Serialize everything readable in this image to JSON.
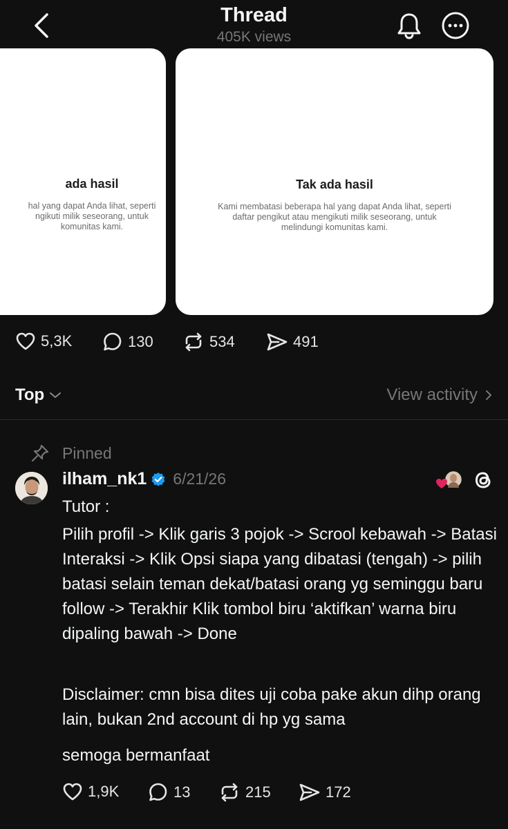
{
  "header": {
    "title": "Thread",
    "views": "405K views"
  },
  "cards": {
    "left": {
      "title": "ada hasil",
      "line1": "hal yang dapat Anda lihat, seperti",
      "line2": "ngikuti milik seseorang, untuk",
      "line3": "komunitas kami."
    },
    "right": {
      "title": "Tak ada hasil",
      "line1": "Kami membatasi beberapa hal yang dapat Anda lihat, seperti",
      "line2": "daftar pengikut atau mengikuti milik seseorang, untuk",
      "line3": "melindungi komunitas kami."
    }
  },
  "thread_actions": {
    "likes": "5,3K",
    "replies": "130",
    "reposts": "534",
    "shares": "491"
  },
  "sort": {
    "label": "Top",
    "view_activity": "View activity"
  },
  "post": {
    "pinned_label": "Pinned",
    "username": "ilham_nk1",
    "date": "6/21/26",
    "text1": "Tutor :",
    "text2": "Pilih profil -> Klik garis 3 pojok -> Scrool kebawah -> Batasi Interaksi -> Klik Opsi siapa yang dibatasi (tengah) -> pilih batasi selain teman dekat/batasi orang yg seminggu baru follow -> Terakhir Klik tombol biru ‘aktifkan’ warna biru dipaling bawah -> Done",
    "text3": "Disclaimer: cmn bisa dites uji coba pake akun dihp orang lain, bukan 2nd account di hp yg sama",
    "text4": "semoga bermanfaat",
    "actions": {
      "likes": "1,9K",
      "replies": "13",
      "reposts": "215",
      "shares": "172"
    }
  },
  "colors": {
    "background": "#101010",
    "muted": "#777777",
    "verified": "#1d9bf0",
    "heart": "#e0245e"
  }
}
